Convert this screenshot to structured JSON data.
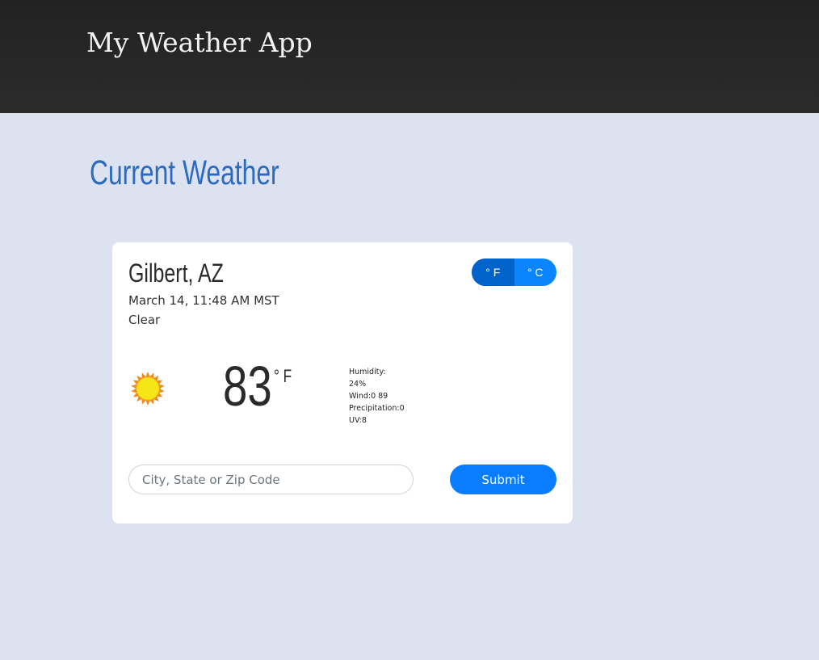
{
  "app": {
    "title": "My Weather App"
  },
  "section": {
    "heading": "Current Weather"
  },
  "weather": {
    "location": "Gilbert, AZ",
    "datetime": "March 14, 11:48 AM MST",
    "condition": "Clear",
    "icon": "sun-icon",
    "temperature": "83",
    "temperature_unit": "° F",
    "humidity_label": "Humidity:",
    "humidity_value": "24%",
    "wind": "Wind:0 89",
    "precipitation": "Precipitation:0",
    "uv": "UV:8"
  },
  "unit_toggle": {
    "fahrenheit_label": "° F",
    "celsius_label": "° C",
    "selected": "fahrenheit"
  },
  "search": {
    "placeholder": "City, State or Zip Code",
    "value": "",
    "submit_label": "Submit"
  },
  "colors": {
    "page_background": "#dce2f0",
    "header_background": "#242424",
    "heading_blue": "#2a6bbf",
    "accent_blue": "#0a7cff",
    "toggle_active": "#0063cc",
    "sun_fill": "#f5e61a",
    "sun_ray": "#f08a1c"
  }
}
